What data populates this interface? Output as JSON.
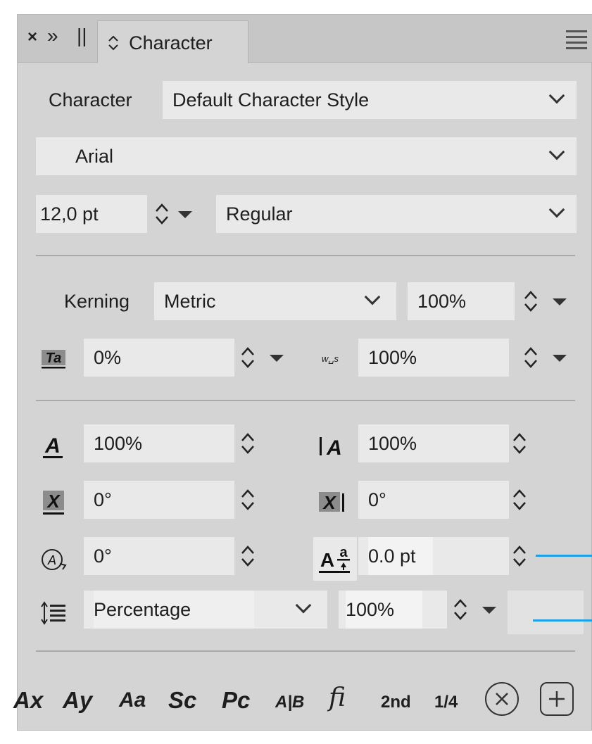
{
  "header": {
    "close_glyph": "×",
    "collapse_glyph": "»",
    "grip_glyph": "||",
    "tab_chevron": "◇",
    "tab_label": "Character"
  },
  "style_row": {
    "label": "Character",
    "value": "Default Character Style"
  },
  "font_family": {
    "value": "Arial"
  },
  "font_size": {
    "value": "12,0 pt"
  },
  "font_style": {
    "value": "Regular"
  },
  "kerning": {
    "label": "Kerning",
    "value": "Metric",
    "percent": "100%"
  },
  "tracking": {
    "value": "0%"
  },
  "word_spacing": {
    "value": "100%",
    "icon_text": "w␣s"
  },
  "vertical_scale": {
    "value": "100%"
  },
  "horizontal_scale": {
    "value": "100%"
  },
  "skew": {
    "value": "0°"
  },
  "skew2": {
    "value": "0°"
  },
  "rotation": {
    "value": "0°"
  },
  "baseline": {
    "value": "0.0 pt"
  },
  "leading": {
    "mode": "Percentage",
    "value": "100%"
  },
  "bottom_bar": {
    "items": [
      "Ax",
      "Ay",
      "Aa",
      "Sc",
      "Pc",
      "A|B",
      "fi",
      "2nd",
      "1/4"
    ]
  },
  "colors": {
    "accent": "#1ea0e6",
    "panel": "#d4d4d4",
    "field": "#e9e9e9"
  }
}
